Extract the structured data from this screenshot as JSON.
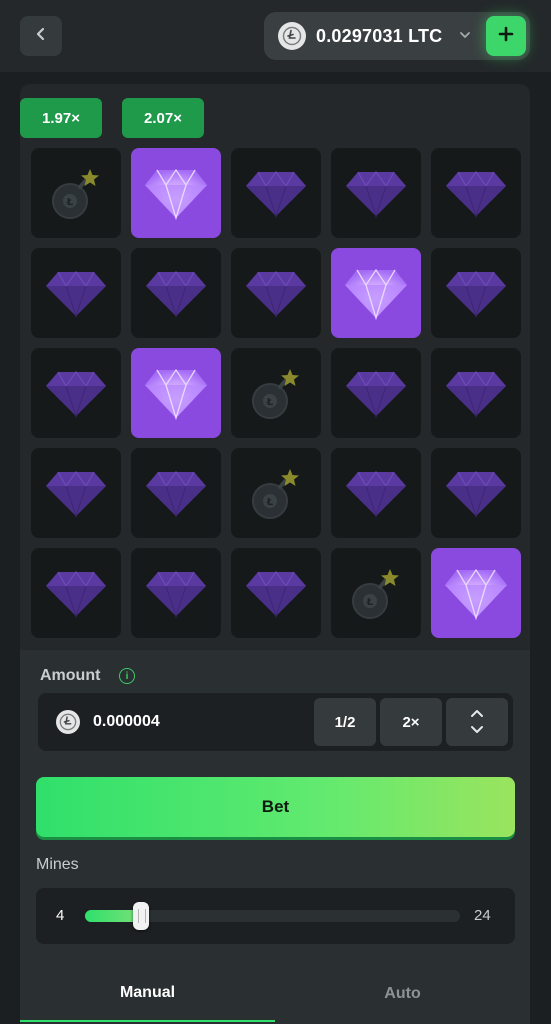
{
  "header": {
    "back_icon": "chevron-left-icon",
    "wallet": {
      "currency_icon": "litecoin-icon",
      "balance": "0.0297031 LTC",
      "dropdown_icon": "chevron-down-icon",
      "add_icon": "plus-icon"
    }
  },
  "board": {
    "multipliers": [
      "1.97×",
      "2.07×"
    ],
    "tiles": [
      [
        "mine",
        "gem-revealed",
        "gem",
        "gem",
        "gem"
      ],
      [
        "gem",
        "gem",
        "gem",
        "gem-revealed",
        "gem"
      ],
      [
        "gem",
        "gem-revealed",
        "mine",
        "gem",
        "gem"
      ],
      [
        "gem",
        "gem",
        "mine",
        "gem",
        "gem"
      ],
      [
        "gem",
        "gem",
        "gem",
        "mine",
        "gem-revealed"
      ]
    ]
  },
  "controls": {
    "amount_label": "Amount",
    "amount_value": "0.000004",
    "half_label": "1/2",
    "double_label": "2×",
    "bet_label": "Bet",
    "mines_label": "Mines",
    "mines_min": "4",
    "mines_max": "24",
    "mines_fraction": 0.13
  },
  "tabs": [
    {
      "label": "Manual",
      "active": true
    },
    {
      "label": "Auto",
      "active": false
    }
  ],
  "colors": {
    "accent_green": "#2fe06b",
    "multiplier_green": "#1f9a4a",
    "revealed_purple": "#8a4ae0",
    "background": "#1c1f21"
  }
}
